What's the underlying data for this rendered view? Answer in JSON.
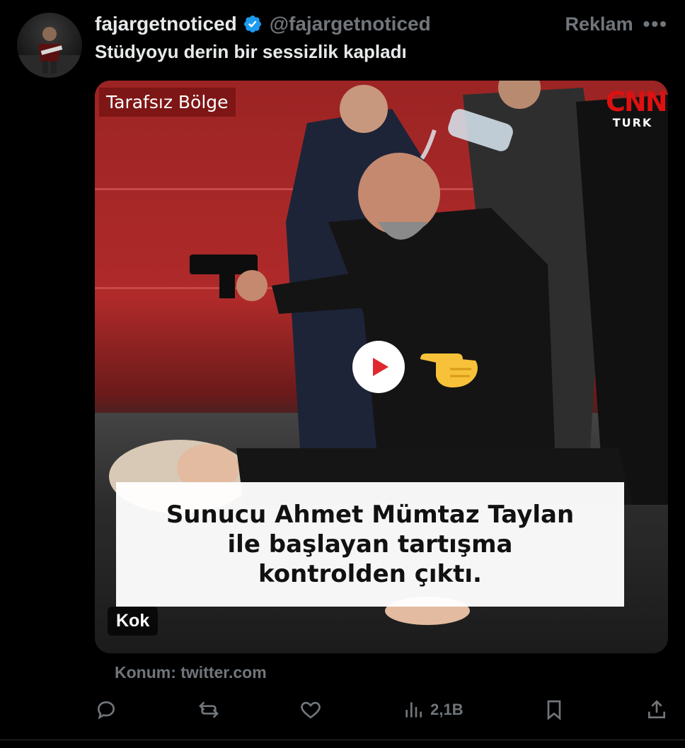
{
  "tweet": {
    "display_name": "fajargetnoticed",
    "handle": "@fajargetnoticed",
    "ad_label": "Reklam",
    "more_icon": "more-horizontal-icon",
    "text": "Stüdyoyu derin bir sessizlik kapladı"
  },
  "media": {
    "program_tag": "Tarafsız Bölge",
    "channel_logo": "CNN",
    "channel_sub": "TURK",
    "caption": "Sunucu Ahmet Mümtaz Taylan\nile başlayan tartışma\nkontrolden çıktı.",
    "source_badge": "Kok",
    "play_icon": "play-icon",
    "emoji": "pointing-right-emoji"
  },
  "location": "Konum: twitter.com",
  "actions": {
    "reply_icon": "reply-icon",
    "retweet_icon": "retweet-icon",
    "like_icon": "heart-icon",
    "views_icon": "views-icon",
    "views_count": "2,1B",
    "bookmark_icon": "bookmark-icon",
    "share_icon": "share-icon"
  },
  "colors": {
    "background": "#000000",
    "text_primary": "#e7e9ea",
    "text_secondary": "#71767b",
    "verified": "#1d9bf0",
    "play_red": "#e0282f"
  }
}
